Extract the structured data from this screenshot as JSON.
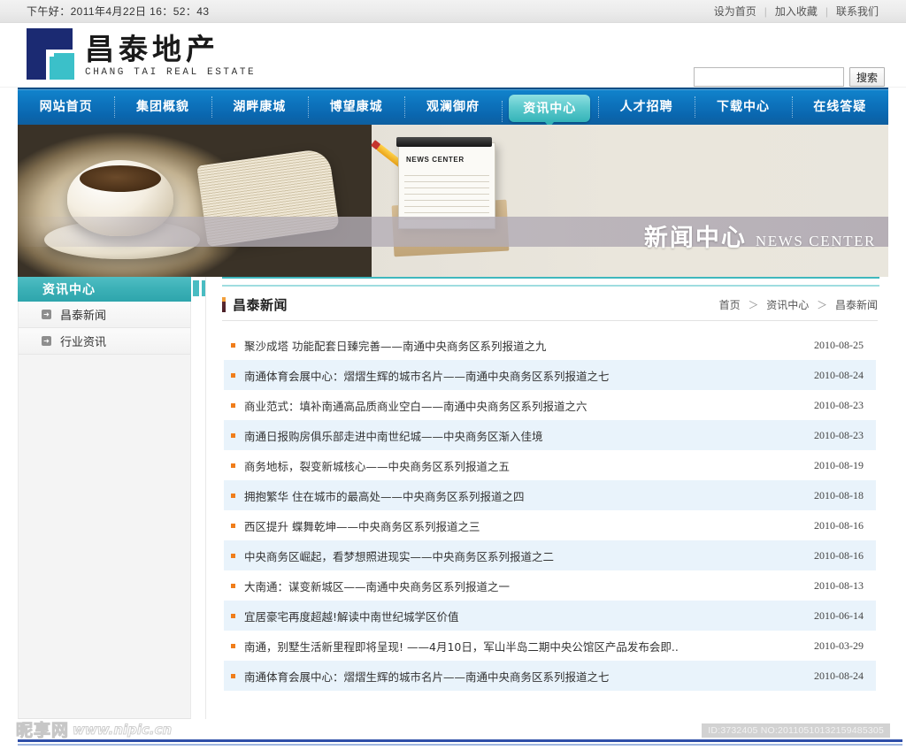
{
  "topbar": {
    "greeting": "下午好：2011年4月22日 16：52：43",
    "links": [
      {
        "label": "设为首页"
      },
      {
        "label": "加入收藏"
      },
      {
        "label": "联系我们"
      }
    ],
    "separator": "|"
  },
  "header": {
    "logo_cn": "昌泰地产",
    "logo_en": "CHANG TAI REAL ESTATE",
    "search": {
      "value": "",
      "placeholder": "",
      "button_label": "搜索"
    }
  },
  "nav": {
    "items": [
      {
        "label": "网站首页",
        "active": false
      },
      {
        "label": "集团概貌",
        "active": false
      },
      {
        "label": "湖畔康城",
        "active": false
      },
      {
        "label": "博望康城",
        "active": false
      },
      {
        "label": "观澜御府",
        "active": false
      },
      {
        "label": "资讯中心",
        "active": true
      },
      {
        "label": "人才招聘",
        "active": false
      },
      {
        "label": "下载中心",
        "active": false
      },
      {
        "label": "在线答疑",
        "active": false
      }
    ]
  },
  "banner": {
    "title_cn": "新闻中心",
    "title_en": "NEWS CENTER",
    "notepad_label": "NEWS CENTER"
  },
  "sidebar": {
    "heading": "资讯中心",
    "items": [
      {
        "label": "昌泰新闻",
        "icon": "arrow-right-icon"
      },
      {
        "label": "行业资讯",
        "icon": "arrow-right-icon"
      }
    ]
  },
  "main": {
    "page_title": "昌泰新闻",
    "breadcrumb": {
      "items": [
        "首页",
        "资讯中心",
        "昌泰新闻"
      ],
      "separator": "＞"
    },
    "news": [
      {
        "title": "聚沙成塔 功能配套日臻完善——南通中央商务区系列报道之九",
        "date": "2010-08-25"
      },
      {
        "title": "南通体育会展中心：熠熠生辉的城市名片——南通中央商务区系列报道之七",
        "date": "2010-08-24"
      },
      {
        "title": "商业范式：填补南通高品质商业空白——南通中央商务区系列报道之六",
        "date": "2010-08-23"
      },
      {
        "title": "南通日报购房俱乐部走进中南世纪城——中央商务区渐入佳境",
        "date": "2010-08-23"
      },
      {
        "title": "商务地标，裂变新城核心——中央商务区系列报道之五",
        "date": "2010-08-19"
      },
      {
        "title": "拥抱繁华 住在城市的最高处——中央商务区系列报道之四",
        "date": "2010-08-18"
      },
      {
        "title": "西区提升 蝶舞乾坤——中央商务区系列报道之三",
        "date": "2010-08-16"
      },
      {
        "title": "中央商务区崛起，看梦想照进现实——中央商务区系列报道之二",
        "date": "2010-08-16"
      },
      {
        "title": "大南通：谋变新城区——南通中央商务区系列报道之一",
        "date": "2010-08-13"
      },
      {
        "title": "宜居豪宅再度超越!解读中南世纪城学区价值",
        "date": "2010-06-14"
      },
      {
        "title": "南通，别墅生活新里程即将呈现! ——4月10日，军山半岛二期中央公馆区产品发布会即..",
        "date": "2010-03-29"
      },
      {
        "title": "南通体育会展中心：熠熠生辉的城市名片——南通中央商务区系列报道之七",
        "date": "2010-08-24"
      }
    ]
  },
  "footer": {
    "watermark_cn": "昵享网",
    "watermark_en": "www.nipic.cn",
    "id_tag": "ID:3732405 NO:20110510132159485305"
  },
  "colors": {
    "nav_blue": "#0d73bd",
    "teal": "#3bb0b6",
    "bullet_orange": "#f07d1a",
    "row_alt": "#e9f3fb",
    "logo_navy": "#1b2a72",
    "logo_cyan": "#3bc0c9",
    "footer_rule": "#2f4fa8"
  }
}
